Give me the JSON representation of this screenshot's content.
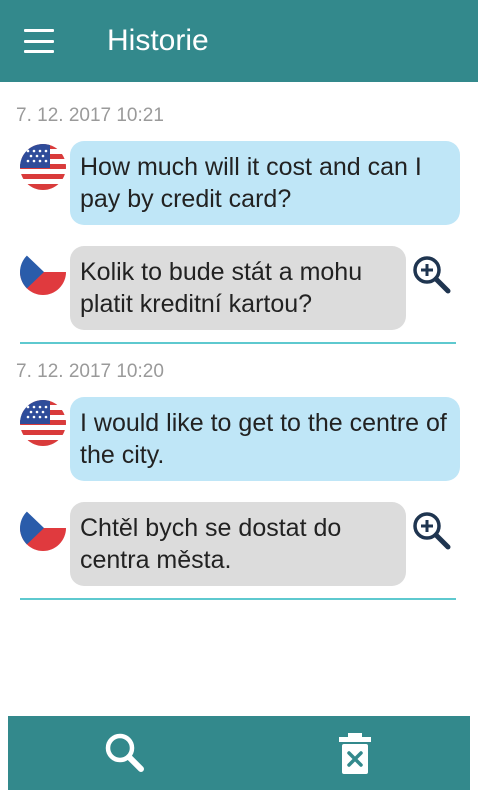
{
  "appbar": {
    "title": "Historie",
    "menu_icon": "hamburger-menu-icon"
  },
  "history": [
    {
      "timestamp": "7. 12. 2017 10:21",
      "source": {
        "flag": "us-flag-icon",
        "text": "How much will it cost and can I pay by credit card?"
      },
      "target": {
        "flag": "cz-flag-icon",
        "text": "Kolik to bude stát a mohu platit kreditní kartou?"
      }
    },
    {
      "timestamp": "7. 12. 2017 10:20",
      "source": {
        "flag": "us-flag-icon",
        "text": "I would like to get to the centre of the city."
      },
      "target": {
        "flag": "cz-flag-icon",
        "text": "Chtěl bych se dostat do centra města."
      }
    }
  ],
  "bottombar": {
    "search_icon": "search-icon",
    "delete_icon": "delete-trash-icon"
  },
  "colors": {
    "primary": "#33898c",
    "source_bubble": "#bfe6f7",
    "target_bubble": "#dcdcdc",
    "divider": "#5ec9cf",
    "timestamp": "#9a9a9a"
  }
}
